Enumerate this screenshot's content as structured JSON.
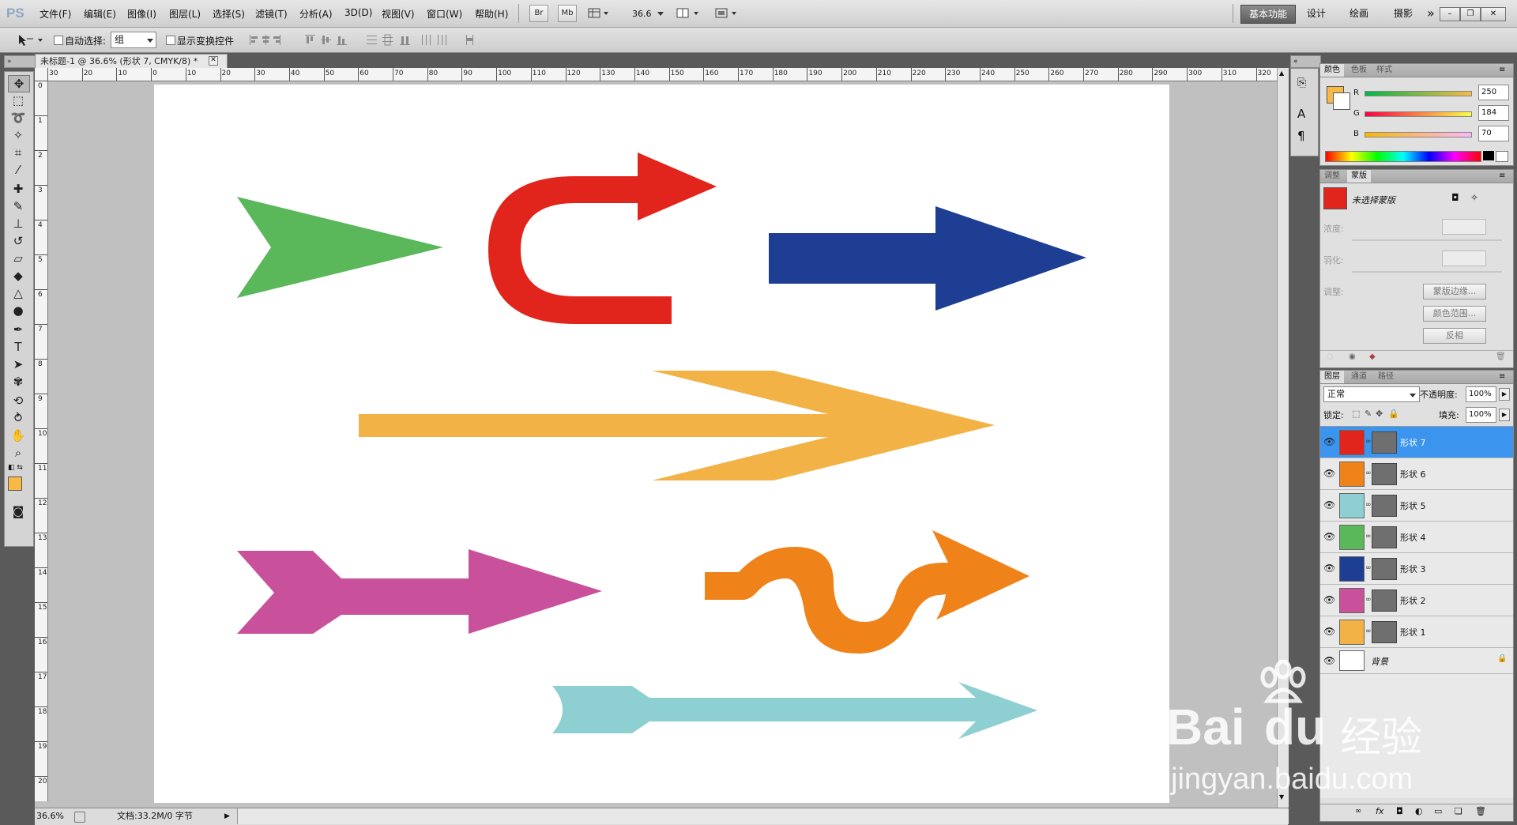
{
  "menubar": {
    "logo": "PS",
    "menus": [
      "文件(F)",
      "编辑(E)",
      "图像(I)",
      "图层(L)",
      "选择(S)",
      "滤镜(T)",
      "分析(A)",
      "3D(D)",
      "视图(V)",
      "窗口(W)",
      "帮助(H)"
    ],
    "bridge_label": "Br",
    "minibridge_label": "Mb",
    "zoom_value": "36.6",
    "workspaces": [
      "基本功能",
      "设计",
      "绘画",
      "摄影"
    ],
    "more": "»"
  },
  "options": {
    "auto_select_label": "自动选择:",
    "auto_select_value": "组",
    "show_transform_label": "显示变换控件"
  },
  "document": {
    "tab_title": "未标题-1 @ 36.6% (形状 7, CMYK/8) *",
    "ruler_top": [
      "30",
      "20",
      "10",
      "0",
      "10",
      "20",
      "30",
      "40",
      "50",
      "60",
      "70",
      "80",
      "90",
      "100",
      "110",
      "120",
      "130",
      "140",
      "150",
      "160",
      "170",
      "180",
      "190",
      "200",
      "210",
      "220",
      "230",
      "240",
      "250",
      "260",
      "270",
      "280",
      "290",
      "300",
      "310",
      "320"
    ],
    "ruler_left": [
      "0",
      "1",
      "2",
      "3",
      "4",
      "5",
      "6",
      "7",
      "8",
      "9",
      "10",
      "11",
      "12",
      "13",
      "14",
      "15",
      "16",
      "17",
      "18",
      "19",
      "20"
    ]
  },
  "canvas": {
    "arrows": [
      {
        "name": "green-arrow",
        "color": "#5ab75a"
      },
      {
        "name": "red-u-arrow",
        "color": "#e1251d"
      },
      {
        "name": "blue-arrow",
        "color": "#1e3e93"
      },
      {
        "name": "yellow-arrow",
        "color": "#f2b246"
      },
      {
        "name": "pink-arrow",
        "color": "#c9519b"
      },
      {
        "name": "orange-wave-arrow",
        "color": "#ef8219"
      },
      {
        "name": "cyan-arrow",
        "color": "#8ecfd1"
      }
    ]
  },
  "statusbar": {
    "zoom": "36.6%",
    "doc_info": "文档:33.2M/0 字节"
  },
  "color_panel": {
    "tabs": [
      "颜色",
      "色板",
      "样式"
    ],
    "fg_color": "#fab846",
    "r_label": "R",
    "r_value": "250",
    "g_label": "G",
    "g_value": "184",
    "b_label": "B",
    "b_value": "70"
  },
  "masks_panel": {
    "tabs": [
      "调整",
      "蒙版"
    ],
    "status": "未选择蒙版",
    "density_label": "浓度:",
    "feather_label": "羽化:",
    "refine_label": "调整:",
    "btn_edge": "蒙版边缘...",
    "btn_range": "颜色范围...",
    "btn_invert": "反相"
  },
  "layers_panel": {
    "tabs": [
      "图层",
      "通道",
      "路径"
    ],
    "blend_mode": "正常",
    "opacity_label": "不透明度:",
    "opacity_value": "100%",
    "lock_label": "锁定:",
    "fill_label": "填充:",
    "fill_value": "100%",
    "layers": [
      {
        "name": "形状 7",
        "color": "#e1251d",
        "selected": true
      },
      {
        "name": "形状 6",
        "color": "#ef8219",
        "selected": false
      },
      {
        "name": "形状 5",
        "color": "#8ecfd1",
        "selected": false
      },
      {
        "name": "形状 4",
        "color": "#5ab75a",
        "selected": false
      },
      {
        "name": "形状 3",
        "color": "#1e3e93",
        "selected": false
      },
      {
        "name": "形状 2",
        "color": "#c9519b",
        "selected": false
      },
      {
        "name": "形状 1",
        "color": "#f2b246",
        "selected": false
      }
    ],
    "background_layer": "背景"
  },
  "watermark": {
    "brand": "Bai",
    "brand2": "du",
    "brand_cn": "经验",
    "url": "jingyan.baidu.com"
  }
}
